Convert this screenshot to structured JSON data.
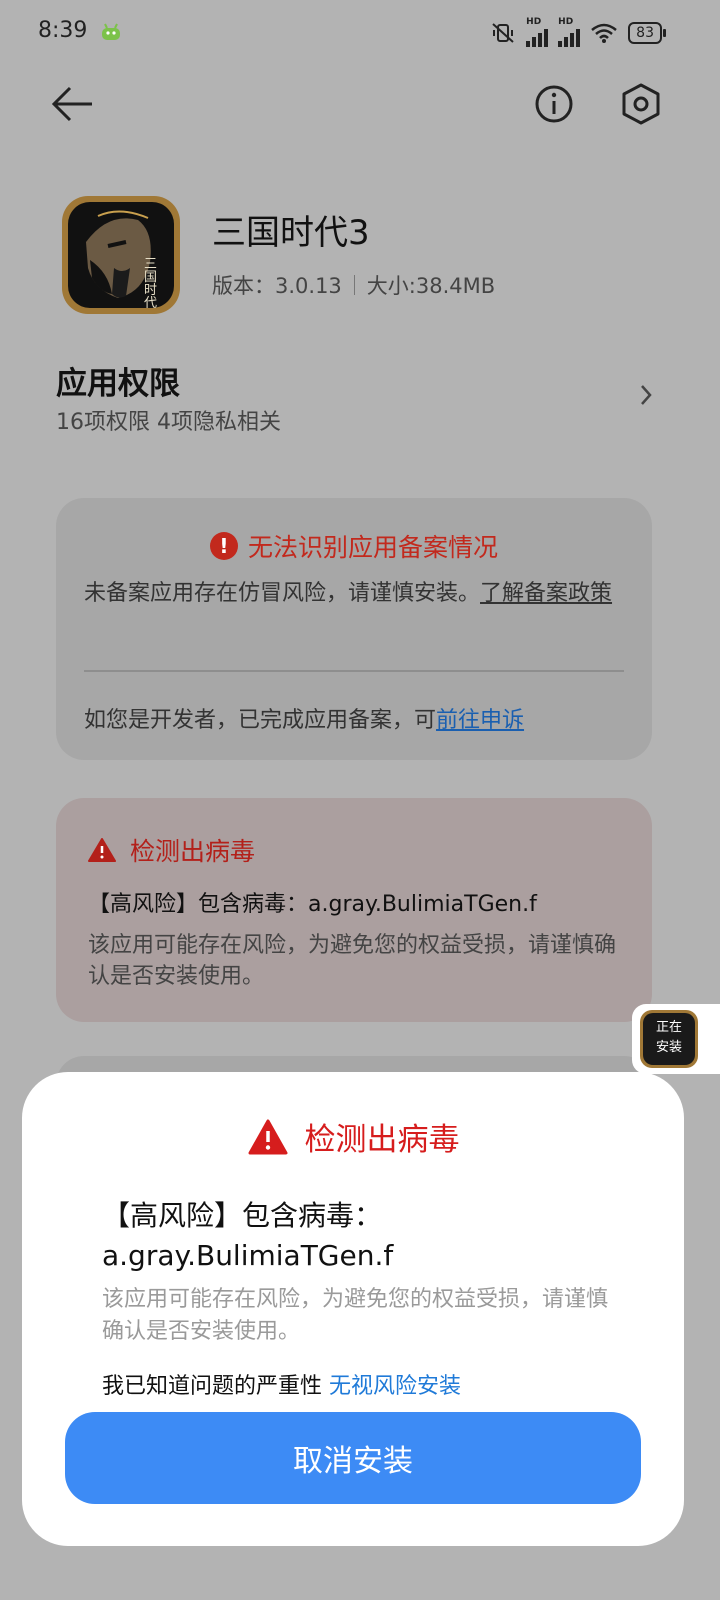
{
  "status_bar": {
    "time": "8:39",
    "hd_label_1": "HD",
    "hd_label_2": "HD",
    "battery": "83"
  },
  "header": {
    "back_icon": "arrow-left-icon",
    "info_icon": "info-circle-icon",
    "settings_icon": "hexagon-settings-icon"
  },
  "app": {
    "name": "三国时代3",
    "version": "版本：3.0.13",
    "size": "大小:38.4MB",
    "icon_text": "三国时代"
  },
  "permissions": {
    "title": "应用权限",
    "subtitle": "16项权限 4项隐私相关"
  },
  "filing_card": {
    "title": "无法识别应用备案情况",
    "description": "未备案应用存在仿冒风险，请谨慎安装。",
    "learn_link": "了解备案政策",
    "developer_text": "如您是开发者，已完成应用备案，可",
    "appeal_link": "前往申诉"
  },
  "virus_card": {
    "title": "检测出病毒",
    "risk_text": "【高风险】包含病毒：a.gray.BulimiaTGen.f",
    "description": "该应用可能存在风险，为避免您的权益受损，请谨慎确认是否安装使用。"
  },
  "floating_install": {
    "label_line1": "正在",
    "label_line2": "安装"
  },
  "dialog": {
    "title": "检测出病毒",
    "risk_line1": "【高风险】包含病毒：",
    "risk_line2": "a.gray.BulimiaTGen.f",
    "description": "该应用可能存在风险，为避免您的权益受损，请谨慎确认是否安装使用。",
    "ack_text": "我已知道问题的严重性",
    "ignore_link": "无视风险安装",
    "cancel_button": "取消安装"
  },
  "colors": {
    "warning_red": "#d61d1d",
    "link_blue": "#1f7ad8",
    "primary_button": "#3d8bf5"
  }
}
